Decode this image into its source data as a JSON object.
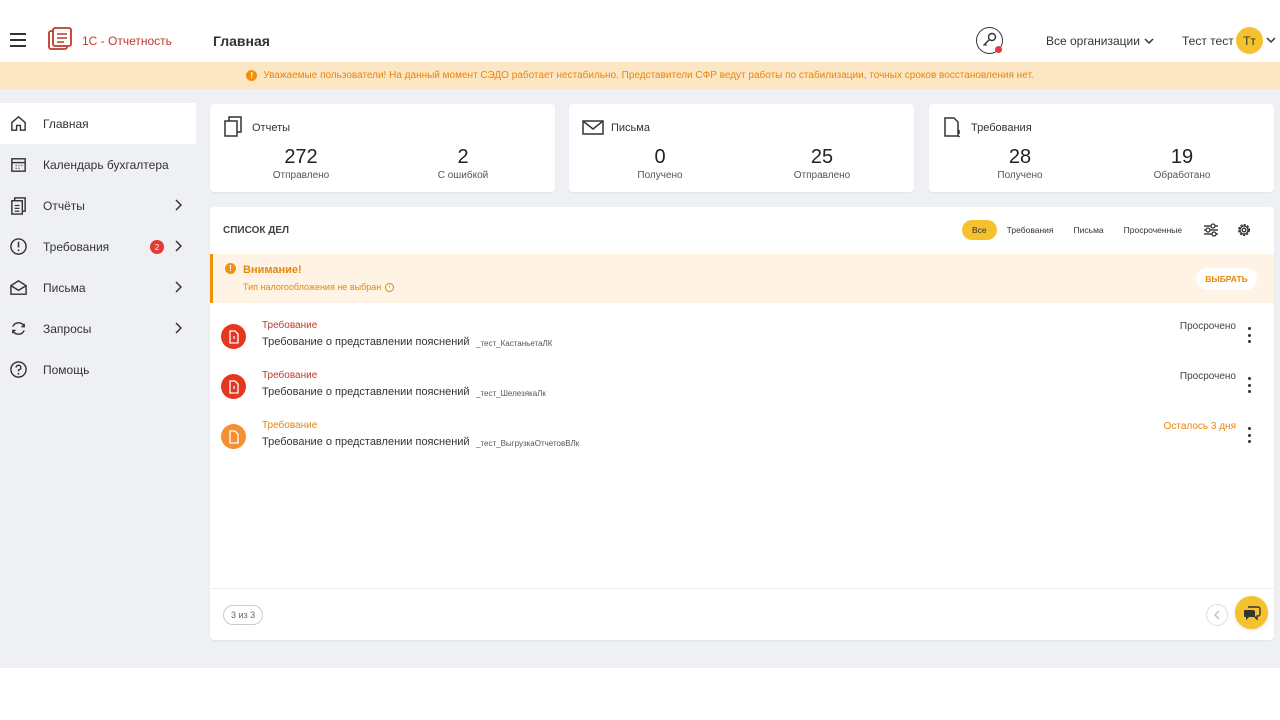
{
  "header": {
    "brand": "1С - Отчетность",
    "page_title": "Главная",
    "org_select": "Все организации",
    "user_name": "Тест тест",
    "user_initials": "Тт"
  },
  "banner": {
    "text": "Уважаемые пользователи! На данный момент СЭДО работает нестабильно. Представители СФР ведут работы по стабилизации, точных сроков восстановления нет."
  },
  "sidebar": {
    "items": [
      {
        "label": "Главная",
        "icon": "home-icon"
      },
      {
        "label": "Календарь бухгалтера",
        "icon": "calendar-icon"
      },
      {
        "label": "Отчёты",
        "icon": "reports-icon"
      },
      {
        "label": "Требования",
        "icon": "alert-circle-icon",
        "badge": "2"
      },
      {
        "label": "Письма",
        "icon": "mail-open-icon"
      },
      {
        "label": "Запросы",
        "icon": "refresh-icon"
      },
      {
        "label": "Помощь",
        "icon": "help-icon"
      }
    ]
  },
  "cards": [
    {
      "title": "Отчеты",
      "icon": "documents-icon",
      "left_value": "272",
      "left_label": "Отправлено",
      "right_value": "2",
      "right_label": "С ошибкой"
    },
    {
      "title": "Письма",
      "icon": "envelope-icon",
      "left_value": "0",
      "left_label": "Получено",
      "right_value": "25",
      "right_label": "Отправлено"
    },
    {
      "title": "Требования",
      "icon": "document-alert-icon",
      "left_value": "28",
      "left_label": "Получено",
      "right_value": "19",
      "right_label": "Обработано"
    }
  ],
  "tasks_panel": {
    "title": "Список дел",
    "filters": [
      "Все",
      "Требования",
      "Письма",
      "Просроченные"
    ],
    "alert": {
      "title": "Внимание!",
      "text": "Тип налогообложения не выбран",
      "button": "ВЫБРАТЬ"
    },
    "tasks": [
      {
        "type": "Требование",
        "name": "Требование о представлении пояснений",
        "org": "_тест_КастаньетаЛК",
        "status": "Просрочено",
        "color": "#e5361f"
      },
      {
        "type": "Требование",
        "name": "Требование о представлении пояснений",
        "org": "_тест_ШелезякаЛк",
        "status": "Просрочено",
        "color": "#e5361f"
      },
      {
        "type": "Требование",
        "name": "Требование о представлении пояснений",
        "org": "_тест_ВыгрузкаОтчетовВЛк",
        "status": "Осталось 3 дня",
        "color": "#f58f33"
      }
    ],
    "pager": "3 из 3"
  },
  "colors": {
    "accent": "#f5c12e",
    "brand": "#c0392b",
    "warning": "#e6870b",
    "danger": "#e5361f"
  }
}
